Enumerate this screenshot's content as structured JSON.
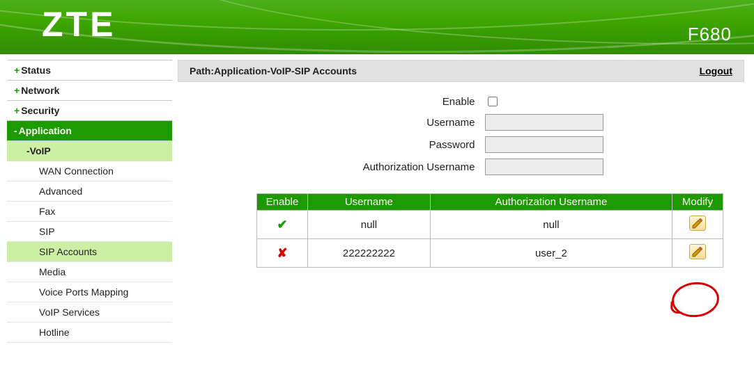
{
  "brand": {
    "logo": "ZTE",
    "model": "F680"
  },
  "nav": {
    "top": [
      {
        "label": "Status",
        "open": false
      },
      {
        "label": "Network",
        "open": false
      },
      {
        "label": "Security",
        "open": false
      },
      {
        "label": "Application",
        "open": true
      }
    ],
    "voip_label": "VoIP",
    "voip_items": [
      "WAN Connection",
      "Advanced",
      "Fax",
      "SIP",
      "SIP Accounts",
      "Media",
      "Voice Ports Mapping",
      "VoIP Services",
      "Hotline"
    ],
    "voip_selected": "SIP Accounts"
  },
  "crumb": {
    "path": "Path:Application-VoIP-SIP Accounts",
    "logout": "Logout"
  },
  "form": {
    "enable_label": "Enable",
    "username_label": "Username",
    "password_label": "Password",
    "auth_label": "Authorization Username",
    "enable_checked": false,
    "username": "",
    "password": "",
    "auth": ""
  },
  "table": {
    "headers": [
      "Enable",
      "Username",
      "Authorization Username",
      "Modify"
    ],
    "rows": [
      {
        "enabled": true,
        "username": "null",
        "auth": "null"
      },
      {
        "enabled": false,
        "username": "222222222",
        "auth": "user_2"
      }
    ]
  }
}
